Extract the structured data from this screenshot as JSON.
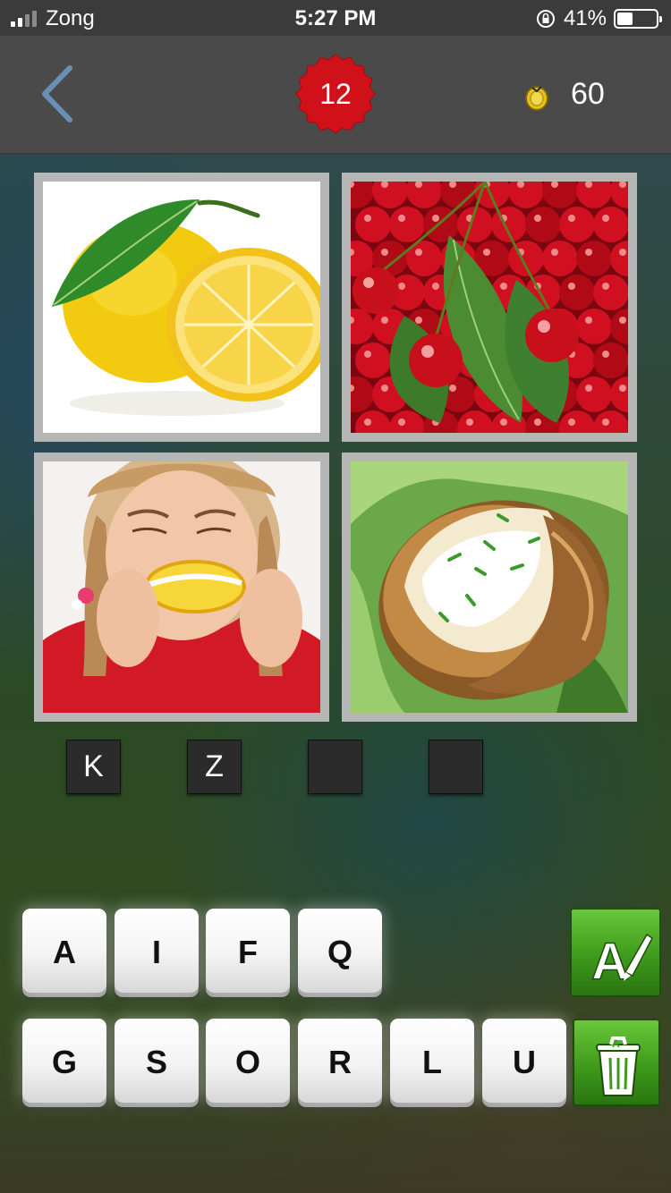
{
  "status_bar": {
    "carrier": "Zong",
    "time": "5:27 PM",
    "battery": "41%"
  },
  "header": {
    "level": "12",
    "coins": "60"
  },
  "icons": {
    "back": "chevron-left-icon",
    "level_badge": "red-starburst-badge",
    "coin": "gold-coin-icon",
    "hint": "reveal-letter-icon",
    "remove": "trash-can-icon"
  },
  "pictures": [
    {
      "subject": "lemons"
    },
    {
      "subject": "cherries"
    },
    {
      "subject": "girl biting lemon"
    },
    {
      "subject": "baked potato with sour cream"
    }
  ],
  "answer_slots": [
    "K",
    "Z",
    "",
    ""
  ],
  "letter_tiles": {
    "row1": [
      "A",
      "I",
      "F",
      "Q"
    ],
    "row2": [
      "G",
      "S",
      "O",
      "R",
      "L",
      "U"
    ]
  },
  "colors": {
    "header_bg": "#4a4a4a",
    "badge_red": "#d0111a",
    "coin_gold": "#e6c11b",
    "action_green": "#3e9a1c"
  }
}
